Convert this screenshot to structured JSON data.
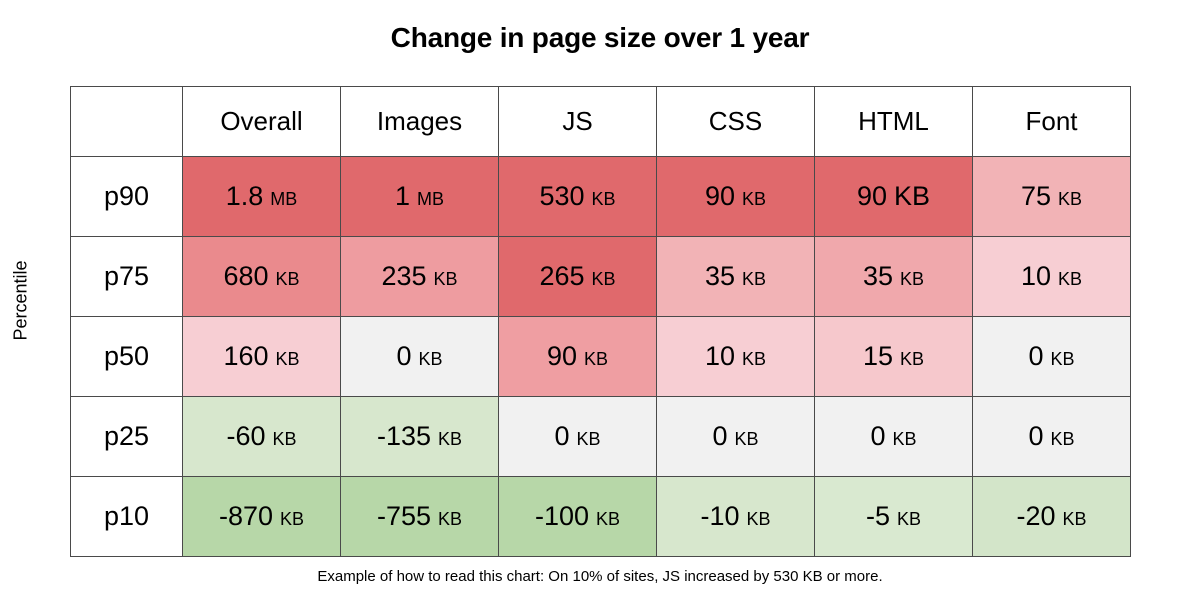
{
  "title": "Change in page size over 1 year",
  "y_axis_label": "Percentile",
  "caption": "Example of how to read this chart: On 10% of sites, JS increased by 530 KB or more.",
  "colors": {
    "red_strong": "#e0696c",
    "red_mid": "#ea8a8d",
    "red_light": "#f2b3b6",
    "red_lighter": "#f7ced3",
    "red_faint": "#fadfe1",
    "neutral": "#f1f1f1",
    "green_strong": "#b7d7a8",
    "green_mid": "#cde4c2",
    "green_light": "#dcecd5",
    "cell_white": "#ffffff",
    "border": "#4a4a4a",
    "text": "#000000"
  },
  "table": {
    "corner_label": "",
    "columns": [
      "Overall",
      "Images",
      "JS",
      "CSS",
      "HTML",
      "Font"
    ],
    "rows": [
      {
        "label": "p90",
        "cells": [
          {
            "value": "1.8",
            "unit": "MB",
            "unit_size": "small",
            "bg": "#e0696c"
          },
          {
            "value": "1",
            "unit": "MB",
            "unit_size": "small",
            "bg": "#e0696c"
          },
          {
            "value": "530",
            "unit": "KB",
            "unit_size": "small",
            "bg": "#e0696c"
          },
          {
            "value": "90",
            "unit": "KB",
            "unit_size": "small",
            "bg": "#e0696c"
          },
          {
            "value": "90",
            "unit": "KB",
            "unit_size": "big",
            "bg": "#e0696c"
          },
          {
            "value": "75",
            "unit": "KB",
            "unit_size": "small",
            "bg": "#f2b3b6"
          }
        ]
      },
      {
        "label": "p75",
        "cells": [
          {
            "value": "680",
            "unit": "KB",
            "unit_size": "small",
            "bg": "#ea8a8d"
          },
          {
            "value": "235",
            "unit": "KB",
            "unit_size": "small",
            "bg": "#ee9ca0"
          },
          {
            "value": "265",
            "unit": "KB",
            "unit_size": "small",
            "bg": "#e0696c"
          },
          {
            "value": "35",
            "unit": "KB",
            "unit_size": "small",
            "bg": "#f2b3b6"
          },
          {
            "value": "35",
            "unit": "KB",
            "unit_size": "small",
            "bg": "#f0a8ac"
          },
          {
            "value": "10",
            "unit": "KB",
            "unit_size": "small",
            "bg": "#f7ced3"
          }
        ]
      },
      {
        "label": "p50",
        "cells": [
          {
            "value": "160",
            "unit": "KB",
            "unit_size": "small",
            "bg": "#f7ced3"
          },
          {
            "value": "0",
            "unit": "KB",
            "unit_size": "small",
            "bg": "#f1f1f1"
          },
          {
            "value": "90",
            "unit": "KB",
            "unit_size": "small",
            "bg": "#ef9ea2"
          },
          {
            "value": "10",
            "unit": "KB",
            "unit_size": "small",
            "bg": "#f7ced3"
          },
          {
            "value": "15",
            "unit": "KB",
            "unit_size": "small",
            "bg": "#f6c8cc"
          },
          {
            "value": "0",
            "unit": "KB",
            "unit_size": "small",
            "bg": "#f1f1f1"
          }
        ]
      },
      {
        "label": "p25",
        "cells": [
          {
            "value": "-60",
            "unit": "KB",
            "unit_size": "small",
            "bg": "#d7e7cd"
          },
          {
            "value": "-135",
            "unit": "KB",
            "unit_size": "small",
            "bg": "#d7e7cd"
          },
          {
            "value": "0",
            "unit": "KB",
            "unit_size": "small",
            "bg": "#f1f1f1"
          },
          {
            "value": "0",
            "unit": "KB",
            "unit_size": "small",
            "bg": "#f1f1f1"
          },
          {
            "value": "0",
            "unit": "KB",
            "unit_size": "small",
            "bg": "#f1f1f1"
          },
          {
            "value": "0",
            "unit": "KB",
            "unit_size": "small",
            "bg": "#f1f1f1"
          }
        ]
      },
      {
        "label": "p10",
        "cells": [
          {
            "value": "-870",
            "unit": "KB",
            "unit_size": "small",
            "bg": "#b7d7a8"
          },
          {
            "value": "-755",
            "unit": "KB",
            "unit_size": "small",
            "bg": "#b7d7a8"
          },
          {
            "value": "-100",
            "unit": "KB",
            "unit_size": "small",
            "bg": "#b7d7a8"
          },
          {
            "value": "-10",
            "unit": "KB",
            "unit_size": "small",
            "bg": "#d7e7cd"
          },
          {
            "value": "-5",
            "unit": "KB",
            "unit_size": "small",
            "bg": "#d9e9d0"
          },
          {
            "value": "-20",
            "unit": "KB",
            "unit_size": "small",
            "bg": "#d3e5c9"
          }
        ]
      }
    ]
  },
  "chart_data": {
    "type": "heatmap",
    "title": "Change in page size over 1 year",
    "xlabel": "",
    "ylabel": "Percentile",
    "annotation": "Example of how to read this chart: On 10% of sites, JS increased by 530 KB or more.",
    "categories": [
      "Overall",
      "Images",
      "JS",
      "CSS",
      "HTML",
      "Font"
    ],
    "rows": [
      "p90",
      "p75",
      "p50",
      "p25",
      "p10"
    ],
    "unit": "KB",
    "values_kb": [
      [
        1800,
        1000,
        530,
        90,
        90,
        75
      ],
      [
        680,
        235,
        265,
        35,
        35,
        10
      ],
      [
        160,
        0,
        90,
        10,
        15,
        0
      ],
      [
        -60,
        -135,
        0,
        0,
        0,
        0
      ],
      [
        -870,
        -755,
        -100,
        -10,
        -5,
        -20
      ]
    ],
    "display_labels": [
      [
        "1.8 MB",
        "1 MB",
        "530 KB",
        "90 KB",
        "90 KB",
        "75 KB"
      ],
      [
        "680 KB",
        "235 KB",
        "265 KB",
        "35 KB",
        "35 KB",
        "10 KB"
      ],
      [
        "160 KB",
        "0 KB",
        "90 KB",
        "10 KB",
        "15 KB",
        "0 KB"
      ],
      [
        "-60 KB",
        "-135 KB",
        "0 KB",
        "0 KB",
        "0 KB",
        "0 KB"
      ],
      [
        "-870 KB",
        "-755 KB",
        "-100 KB",
        "-10 KB",
        "-5 KB",
        "-20 KB"
      ]
    ],
    "colorscale": {
      "positive": "red",
      "zero": "neutral-gray",
      "negative": "green"
    },
    "grid": true,
    "legend": "none"
  }
}
